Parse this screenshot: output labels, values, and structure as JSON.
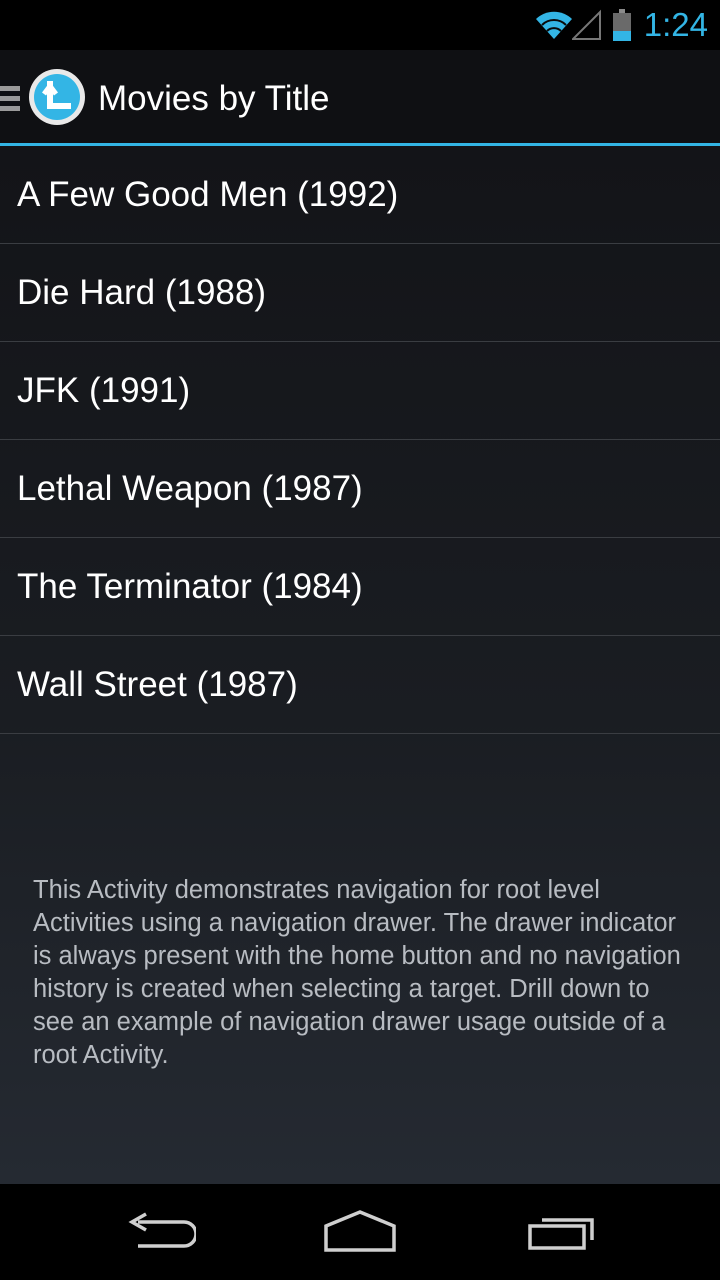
{
  "status_bar": {
    "time": "1:24",
    "icons": [
      "wifi-icon",
      "signal-icon",
      "battery-icon"
    ],
    "accent_color": "#33b5e5"
  },
  "action_bar": {
    "title": "Movies by Title",
    "icons": [
      "drawer-indicator-icon",
      "app-icon"
    ]
  },
  "movies": [
    "A Few Good Men (1992)",
    "Die Hard (1988)",
    "JFK (1991)",
    "Lethal Weapon (1987)",
    "The Terminator (1984)",
    "Wall Street (1987)"
  ],
  "description": "This Activity demonstrates navigation for root level Activities using a navigation drawer. The drawer indicator is always present with the home button and no navigation history is created when selecting a target. Drill down to see an example of navigation drawer usage outside of a root Activity.",
  "nav_bar": {
    "icons": [
      "back-icon",
      "home-icon",
      "recents-icon"
    ]
  }
}
